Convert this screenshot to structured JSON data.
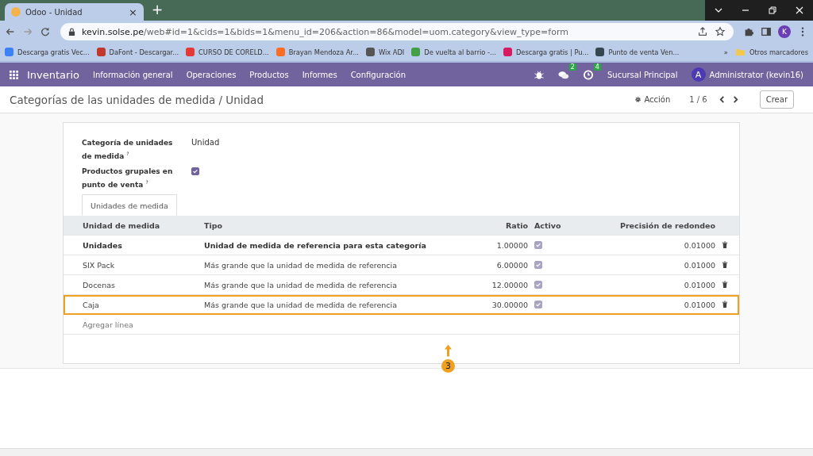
{
  "browser": {
    "tab": {
      "title": "Odoo - Unidad",
      "close": "×"
    },
    "new_tab": "+",
    "url": {
      "host": "kevin.solse.pe",
      "path": "/web#id=1&cids=1&bids=1&menu_id=206&action=86&model=uom.category&view_type=form"
    },
    "profile": "K",
    "bookmarks": [
      {
        "label": "Descarga gratis Vec...",
        "color": "#3b82f6"
      },
      {
        "label": "DaFont - Descargar...",
        "color": "#c0392b"
      },
      {
        "label": "CURSO DE CORELD...",
        "color": "#e53935"
      },
      {
        "label": "Brayan Mendoza Ar...",
        "color": "#fc6d26"
      },
      {
        "label": "Wix ADI",
        "color": "#555555"
      },
      {
        "label": "De vuelta al barrio -...",
        "color": "#43a047"
      },
      {
        "label": "Descarga gratis | Pu...",
        "color": "#d81b60"
      },
      {
        "label": "Punto de venta Ven...",
        "color": "#37474f"
      }
    ],
    "more_bookmarks": "»",
    "other_bookmarks": "Otros marcadores"
  },
  "navbar": {
    "app": "Inventario",
    "menus": [
      "Información general",
      "Operaciones",
      "Productos",
      "Informes",
      "Configuración"
    ],
    "messages_count": "2",
    "activities_count": "4",
    "company": "Sucursal Principal",
    "avatar": "A",
    "user": "Administrator (kevin16)"
  },
  "control_panel": {
    "breadcrumb": "Categorías de las unidades de medida / Unidad",
    "action": "Acción",
    "pager": "1 / 6",
    "create": "Crear"
  },
  "form": {
    "fields": [
      {
        "kind": "text",
        "label": "Categoría de unidades de medida",
        "help": "?",
        "value": "Unidad"
      },
      {
        "kind": "checkbox",
        "label": "Productos grupales en punto de venta",
        "help": "?",
        "checked": true
      }
    ],
    "tabs": [
      {
        "label": "Unidades de medida",
        "selected": true
      }
    ],
    "table": {
      "columns": [
        "Unidad de medida",
        "Tipo",
        "Ratio",
        "Activo",
        "Precisión de redondeo"
      ],
      "rows": [
        {
          "name": "Unidades",
          "type": "Unidad de medida de referencia para esta categoría",
          "ratio": "1.00000",
          "active": true,
          "rounding": "0.01000",
          "reference": true,
          "highlighted": false
        },
        {
          "name": "SIX Pack",
          "type": "Más grande que la unidad de medida de referencia",
          "ratio": "6.00000",
          "active": true,
          "rounding": "0.01000",
          "reference": false,
          "highlighted": false
        },
        {
          "name": "Docenas",
          "type": "Más grande que la unidad de medida de referencia",
          "ratio": "12.00000",
          "active": true,
          "rounding": "0.01000",
          "reference": false,
          "highlighted": false
        },
        {
          "name": "Caja",
          "type": "Más grande que la unidad de medida de referencia",
          "ratio": "30.00000",
          "active": true,
          "rounding": "0.01000",
          "reference": false,
          "highlighted": true
        }
      ],
      "add_line": "Agregar línea"
    }
  },
  "annotation": {
    "label": "3"
  }
}
